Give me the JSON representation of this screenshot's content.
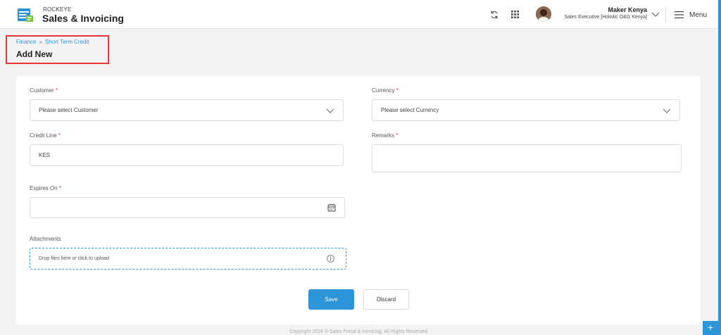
{
  "app": {
    "brand_small": "ROCKEYE",
    "brand_title": "Sales & Invoicing",
    "accent_color": "#2b95d8"
  },
  "header": {
    "icons": [
      "refresh-icon",
      "apps-grid-icon",
      "chevron-down-icon",
      "menu-icon"
    ],
    "user_name": "Maker Kenya",
    "user_role": "Sales Executive [Holistic O&G Kenya]",
    "menu_label": "Menu"
  },
  "breadcrumb": {
    "items": [
      "Finance",
      "Short Term Credit"
    ],
    "separator": "»"
  },
  "page": {
    "title": "Add New"
  },
  "form": {
    "customer": {
      "label": "Customer",
      "required_mark": "*",
      "value": "Please select Customer"
    },
    "currency": {
      "label": "Currency",
      "required_mark": "*",
      "value": "Please select Currency"
    },
    "credit_line": {
      "label": "Credit Line",
      "required_mark": "*",
      "value": "KES"
    },
    "remarks": {
      "label": "Remarks",
      "required_mark": "*",
      "value": ""
    },
    "expires_on": {
      "label": "Expires On",
      "required_mark": "*",
      "value": ""
    },
    "attachments": {
      "label": "Attachments",
      "placeholder": "Drop files here or click to upload"
    }
  },
  "actions": {
    "save_label": "Save",
    "discard_label": "Discard"
  },
  "footer": {
    "text": "Copyright 2024 © Sales Portal & Invoicing. All Rights Reserved."
  },
  "fab": {
    "label": "+"
  }
}
